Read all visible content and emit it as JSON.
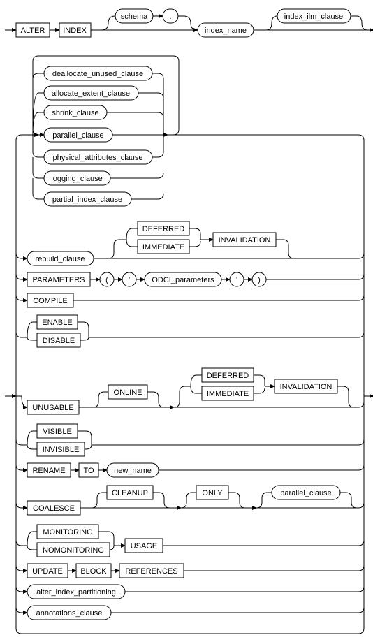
{
  "kw": {
    "alter": "ALTER",
    "index": "INDEX",
    "deferred": "DEFERRED",
    "immediate": "IMMEDIATE",
    "invalidation": "INVALIDATION",
    "parameters": "PARAMETERS",
    "compile": "COMPILE",
    "enable": "ENABLE",
    "disable": "DISABLE",
    "unusable": "UNUSABLE",
    "online": "ONLINE",
    "visible": "VISIBLE",
    "invisible": "INVISIBLE",
    "rename": "RENAME",
    "to": "TO",
    "coalesce": "COALESCE",
    "cleanup": "CLEANUP",
    "only": "ONLY",
    "monitoring": "MONITORING",
    "nomonitoring": "NOMONITORING",
    "usage": "USAGE",
    "update": "UPDATE",
    "block": "BLOCK",
    "references": "REFERENCES",
    "lparen": "(",
    "rparen": ")",
    "squote": "'",
    "dot": "."
  },
  "cl": {
    "schema": "schema",
    "index_name": "index_name",
    "index_ilm_clause": "index_ilm_clause",
    "deallocate_unused_clause": "deallocate_unused_clause",
    "allocate_extent_clause": "allocate_extent_clause",
    "shrink_clause": "shrink_clause",
    "parallel_clause": "parallel_clause",
    "physical_attributes_clause": "physical_attributes_clause",
    "logging_clause": "logging_clause",
    "partial_index_clause": "partial_index_clause",
    "rebuild_clause": "rebuild_clause",
    "odci_parameters": "ODCI_parameters",
    "new_name": "new_name",
    "alter_index_partitioning": "alter_index_partitioning",
    "annotations_clause": "annotations_clause"
  }
}
